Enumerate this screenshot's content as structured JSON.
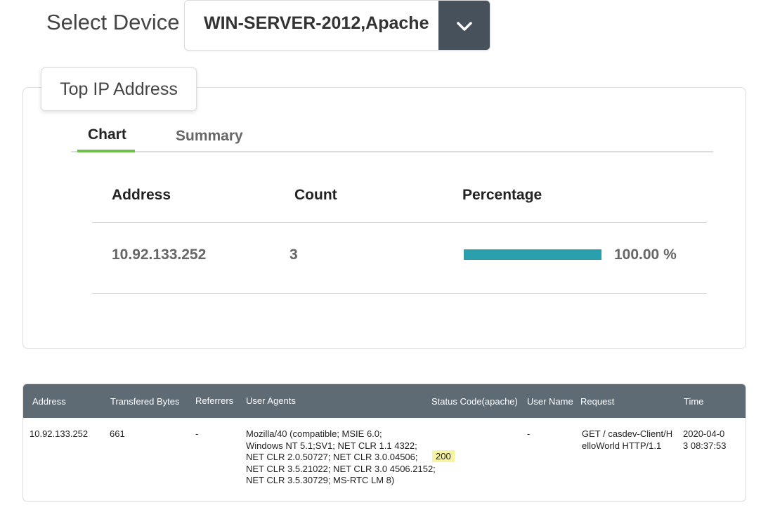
{
  "device": {
    "label": "Select Device",
    "selected": "WIN-SERVER-2012,Apache",
    "toggle_icon": "chevron-down-icon"
  },
  "top_ip": {
    "title": "Top IP Address",
    "tabs": [
      {
        "label": "Chart",
        "active": true
      },
      {
        "label": "Summary",
        "active": false
      }
    ],
    "columns": [
      "Address",
      "Count",
      "Percentage"
    ],
    "rows": [
      {
        "address": "10.92.133.252",
        "count": "3",
        "percentage": "100.00 %",
        "fraction": 1.0
      }
    ],
    "bar_color": "#2a9fad",
    "tab_accent": "#6cbf4a"
  },
  "logs": {
    "columns": [
      "Address",
      "Transfered Bytes",
      "Referrers",
      "User Agents",
      "Status Code(apache)",
      "User Name",
      "Request",
      "Time"
    ],
    "rows": [
      {
        "address": "10.92.133.252",
        "bytes": "661",
        "referrer": "-",
        "user_agent_lines": [
          "Mozilla/40 (compatible; MSIE 6.0;",
          "Windows NT 5.1;SV1; NET CLR 1.1 4322;",
          "NET CLR 2.0.50727; NET CLR 3.0.04506;",
          "NET CLR 3.5.21022; NET CLR 3.0 4506.2152;",
          "NET CLR 3.5.30729; MS-RTC LM 8)"
        ],
        "status": "200",
        "user_name": "-",
        "request_lines": [
          "GET / casdev-Client/H",
          "elloWorld HTTP/1.1"
        ],
        "time_lines": [
          "2020-04-0",
          "3 08:37:53"
        ]
      }
    ],
    "header_color": "#5f6b74",
    "status_highlight": "#f7f3a4"
  }
}
